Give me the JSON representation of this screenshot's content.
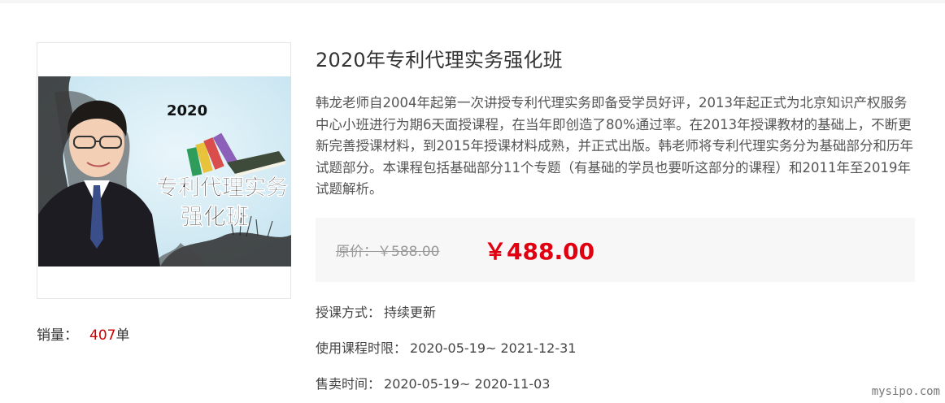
{
  "course": {
    "title": "2020年专利代理实务强化班",
    "description": "韩龙老师自2004年起第一次讲授专利代理实务即备受学员好评，2013年起正式为北京知识产权服务中心小班进行为期6天面授课程，在当年即创造了80%通过率。在2013年授课教材的基础上，不断更新完善授课材料，到2015年授课材料成熟，并正式出版。韩老师将专利代理实务分为基础部分和历年试题部分。本课程包括基础部分11个专题（有基础的学员也要听这部分的课程）和2011年至2019年试题解析。",
    "cover": {
      "year": "2020",
      "line1": "专利代理实务",
      "line2": "强化班"
    }
  },
  "sales": {
    "label": "销量：",
    "count": "407",
    "unit": "单"
  },
  "price": {
    "original": "原价：￥588.00",
    "current": "￥488.00"
  },
  "details": {
    "mode_label": "授课方式：",
    "mode_value": "持续更新",
    "period_label": "使用课程时限：",
    "period_value": "2020-05-19~ 2021-12-31",
    "sale_label": "售卖时间：",
    "sale_value": "2020-05-19~ 2020-11-03"
  },
  "watermark": "mysipo.com",
  "colors": {
    "price": "#e1000f",
    "sales_count": "#cc0000",
    "cover_bg": "#cbe7f2"
  }
}
